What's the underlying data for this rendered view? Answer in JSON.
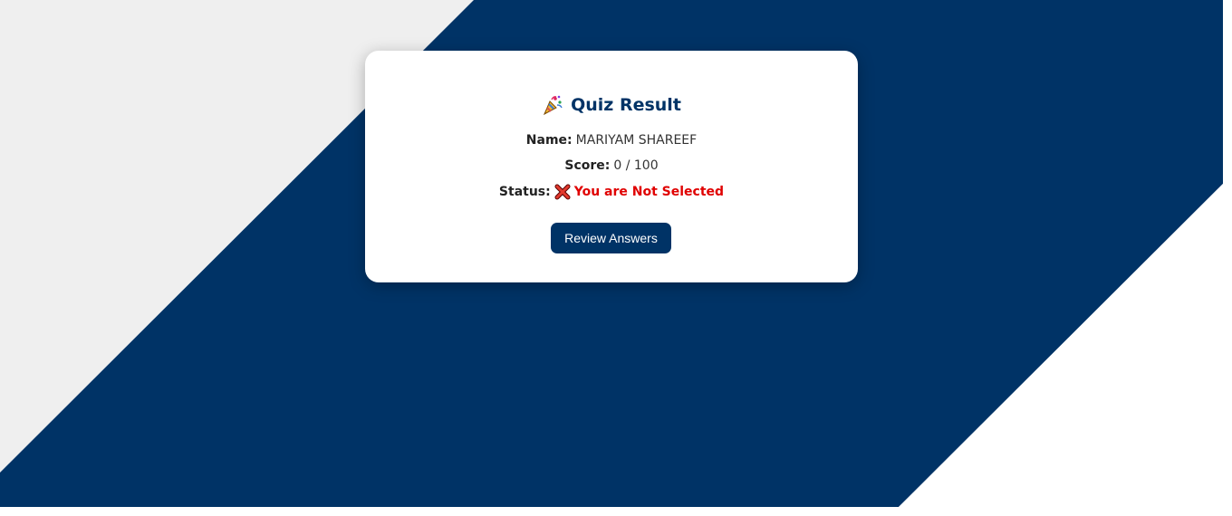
{
  "colors": {
    "background_left": "#efefef",
    "background_band": "#003366",
    "background_right": "#ffffff",
    "card": "#ffffff",
    "title": "#003366",
    "button": "#003366",
    "status_fail": "#e00000"
  },
  "result": {
    "title_icon": "party-popper-icon",
    "title": "Quiz Result",
    "name_label": "Name:",
    "name_value": "MARIYAM SHAREEF",
    "score_label": "Score:",
    "score_value": "0 / 100",
    "status_label": "Status:",
    "status_icon": "cross-mark-icon",
    "status_value": "You are Not Selected"
  },
  "actions": {
    "review_label": "Review Answers"
  }
}
